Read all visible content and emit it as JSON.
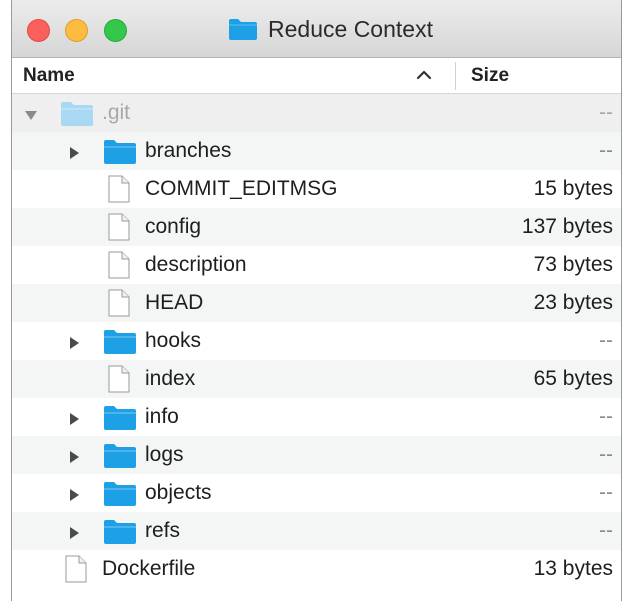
{
  "window": {
    "title": "Reduce Context"
  },
  "columns": {
    "name": "Name",
    "size": "Size"
  },
  "rows": [
    {
      "name": ".git",
      "size": "--",
      "kind": "folder",
      "level": 0,
      "disclosure": "expanded",
      "dimmed": true
    },
    {
      "name": "branches",
      "size": "--",
      "kind": "folder",
      "level": 1,
      "disclosure": "collapsed"
    },
    {
      "name": "COMMIT_EDITMSG",
      "size": "15 bytes",
      "kind": "file",
      "level": 1,
      "disclosure": "none"
    },
    {
      "name": "config",
      "size": "137 bytes",
      "kind": "file",
      "level": 1,
      "disclosure": "none"
    },
    {
      "name": "description",
      "size": "73 bytes",
      "kind": "file",
      "level": 1,
      "disclosure": "none"
    },
    {
      "name": "HEAD",
      "size": "23 bytes",
      "kind": "file",
      "level": 1,
      "disclosure": "none"
    },
    {
      "name": "hooks",
      "size": "--",
      "kind": "folder",
      "level": 1,
      "disclosure": "collapsed"
    },
    {
      "name": "index",
      "size": "65 bytes",
      "kind": "file",
      "level": 1,
      "disclosure": "none"
    },
    {
      "name": "info",
      "size": "--",
      "kind": "folder",
      "level": 1,
      "disclosure": "collapsed"
    },
    {
      "name": "logs",
      "size": "--",
      "kind": "folder",
      "level": 1,
      "disclosure": "collapsed"
    },
    {
      "name": "objects",
      "size": "--",
      "kind": "folder",
      "level": 1,
      "disclosure": "collapsed"
    },
    {
      "name": "refs",
      "size": "--",
      "kind": "folder",
      "level": 1,
      "disclosure": "collapsed"
    },
    {
      "name": "Dockerfile",
      "size": "13 bytes",
      "kind": "file",
      "level": 0,
      "disclosure": "none"
    }
  ],
  "colors": {
    "folder": "#1ea0e6",
    "folder_dim": "#a9d8f3",
    "close": "#fc605c",
    "minimize": "#fdbc40",
    "maximize": "#34c84a"
  }
}
